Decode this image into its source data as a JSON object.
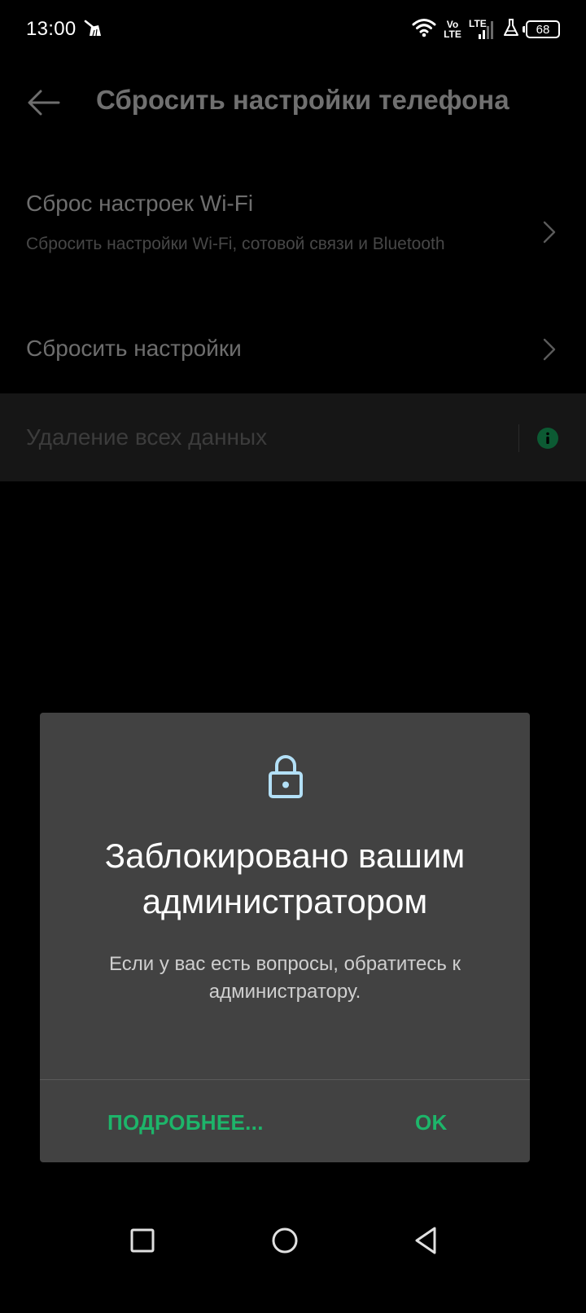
{
  "status_bar": {
    "time": "13:00",
    "volte_line1": "Vo",
    "volte_line2": "LTE",
    "lte": "LTE",
    "battery": "68",
    "icons": [
      "cleaner-icon",
      "wifi-icon",
      "volte-icon",
      "cell-signal-icon",
      "flask-icon",
      "battery-icon"
    ]
  },
  "app_bar": {
    "title": "Сбросить настройки телефона"
  },
  "settings": {
    "items": [
      {
        "title": "Сброс настроек Wi-Fi",
        "subtitle": "Сбросить настройки Wi-Fi, сотовой связи и Bluetooth"
      },
      {
        "title": "Сбросить настройки"
      },
      {
        "title": "Удаление всех данных"
      }
    ]
  },
  "dialog": {
    "title": "Заблокировано вашим администратором",
    "message": "Если у вас есть вопросы, обратитесь к администратору.",
    "more_label": "ПОДРОБНЕЕ...",
    "ok_label": "OK"
  },
  "colors": {
    "accent": "#1db56a",
    "dialog_bg": "#424242",
    "lock_icon": "#b3e0f7",
    "background": "#000000"
  }
}
